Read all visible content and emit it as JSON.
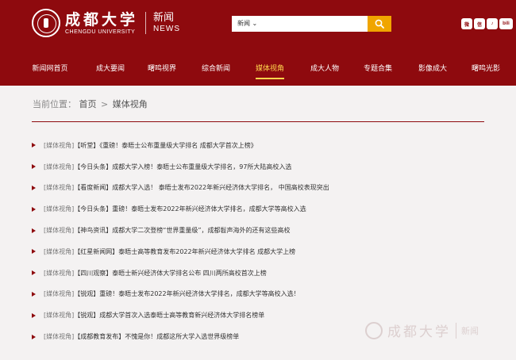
{
  "header": {
    "logo_cn": "成都大学",
    "logo_en": "CHENGDU UNIVERSITY",
    "news_cn": "新闻",
    "news_en": "NEWS",
    "search": {
      "selected": "新闻 ⌄",
      "button_icon": "search-icon"
    },
    "socials": [
      {
        "icon": "weibo-icon",
        "glyph": "微"
      },
      {
        "icon": "wechat-icon",
        "glyph": "信"
      },
      {
        "icon": "douyin-icon",
        "glyph": "♪"
      },
      {
        "icon": "bilibili-icon",
        "glyph": "bili"
      }
    ]
  },
  "nav": {
    "items": [
      {
        "label": "新闻网首页"
      },
      {
        "label": "成大要闻"
      },
      {
        "label": "曙鸣视界"
      },
      {
        "label": "综合新闻"
      },
      {
        "label": "媒体视角"
      },
      {
        "label": "成大人物"
      },
      {
        "label": "专题合集"
      },
      {
        "label": "影像成大"
      },
      {
        "label": "曙鸣光影"
      }
    ],
    "active_index": 4
  },
  "breadcrumb": {
    "prefix": "当前位置：",
    "home": "首页",
    "separator": ">",
    "current": "媒体视角"
  },
  "articles": [
    {
      "category": "[媒体视角]",
      "title": "【听堂】《重磅！泰晤士公布重量级大学排名 成都大学首次上榜》"
    },
    {
      "category": "[媒体视角]",
      "title": "【今日头条】成都大学入榜！泰晤士公布重量级大学排名，97所大陆高校入选"
    },
    {
      "category": "[媒体视角]",
      "title": "【看度新闻】成都大学入选！ 泰晤士发布2022年新兴经济体大学排名， 中国高校表现突出"
    },
    {
      "category": "[媒体视角]",
      "title": "【今日头条】重磅！泰晤士发布2022年新兴经济体大学排名，成都大学等高校入选"
    },
    {
      "category": "[媒体视角]",
      "title": "【神鸟资讯】成都大学二次登榜“世界重量级”，成都髫声海外的还有这些高校"
    },
    {
      "category": "[媒体视角]",
      "title": "【红星新闻网】泰晤士高等教育发布2022年新兴经济体大学排名 成都大学上榜"
    },
    {
      "category": "[媒体视角]",
      "title": "【四川观察】泰晤士新兴经济体大学排名公布 四川两所高校首次上榜"
    },
    {
      "category": "[媒体视角]",
      "title": "【锐观】重磅！泰晤士发布2022年新兴经济体大学排名，成都大学等高校入选！"
    },
    {
      "category": "[媒体视角]",
      "title": "【锐观】成都大学首次入选泰晤士高等教育新兴经济体大学排名榜单"
    },
    {
      "category": "[媒体视角]",
      "title": "【成都教育发布】不愧是你！成都这所大学入选世界级榜单"
    }
  ],
  "watermark": {
    "cn": "成都大学",
    "news": "新闻"
  },
  "colors": {
    "brand": "#8e0a0e",
    "accent": "#ffd44d",
    "search_button": "#f0a500"
  }
}
